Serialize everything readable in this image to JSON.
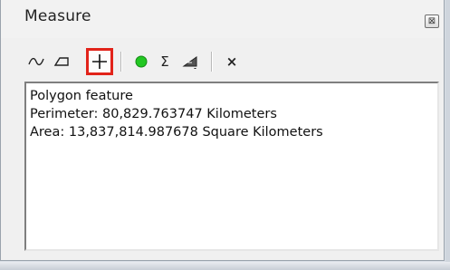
{
  "window": {
    "title": "Measure"
  },
  "toolbar": {
    "tools": [
      {
        "icon": "measure-line-icon"
      },
      {
        "icon": "measure-area-icon"
      },
      {
        "icon": "measure-feature-icon",
        "active": true
      },
      {
        "icon": "show-features-icon"
      },
      {
        "icon": "sum-icon"
      },
      {
        "icon": "choose-units-icon"
      },
      {
        "icon": "clear-icon"
      }
    ],
    "active_color": "#e2231a",
    "feature_dot_color": "#22c722"
  },
  "output": {
    "line1": "Polygon feature",
    "line2": "Perimeter: 80,829.763747 Kilometers",
    "line3": "Area: 13,837,814.987678 Square Kilometers"
  }
}
